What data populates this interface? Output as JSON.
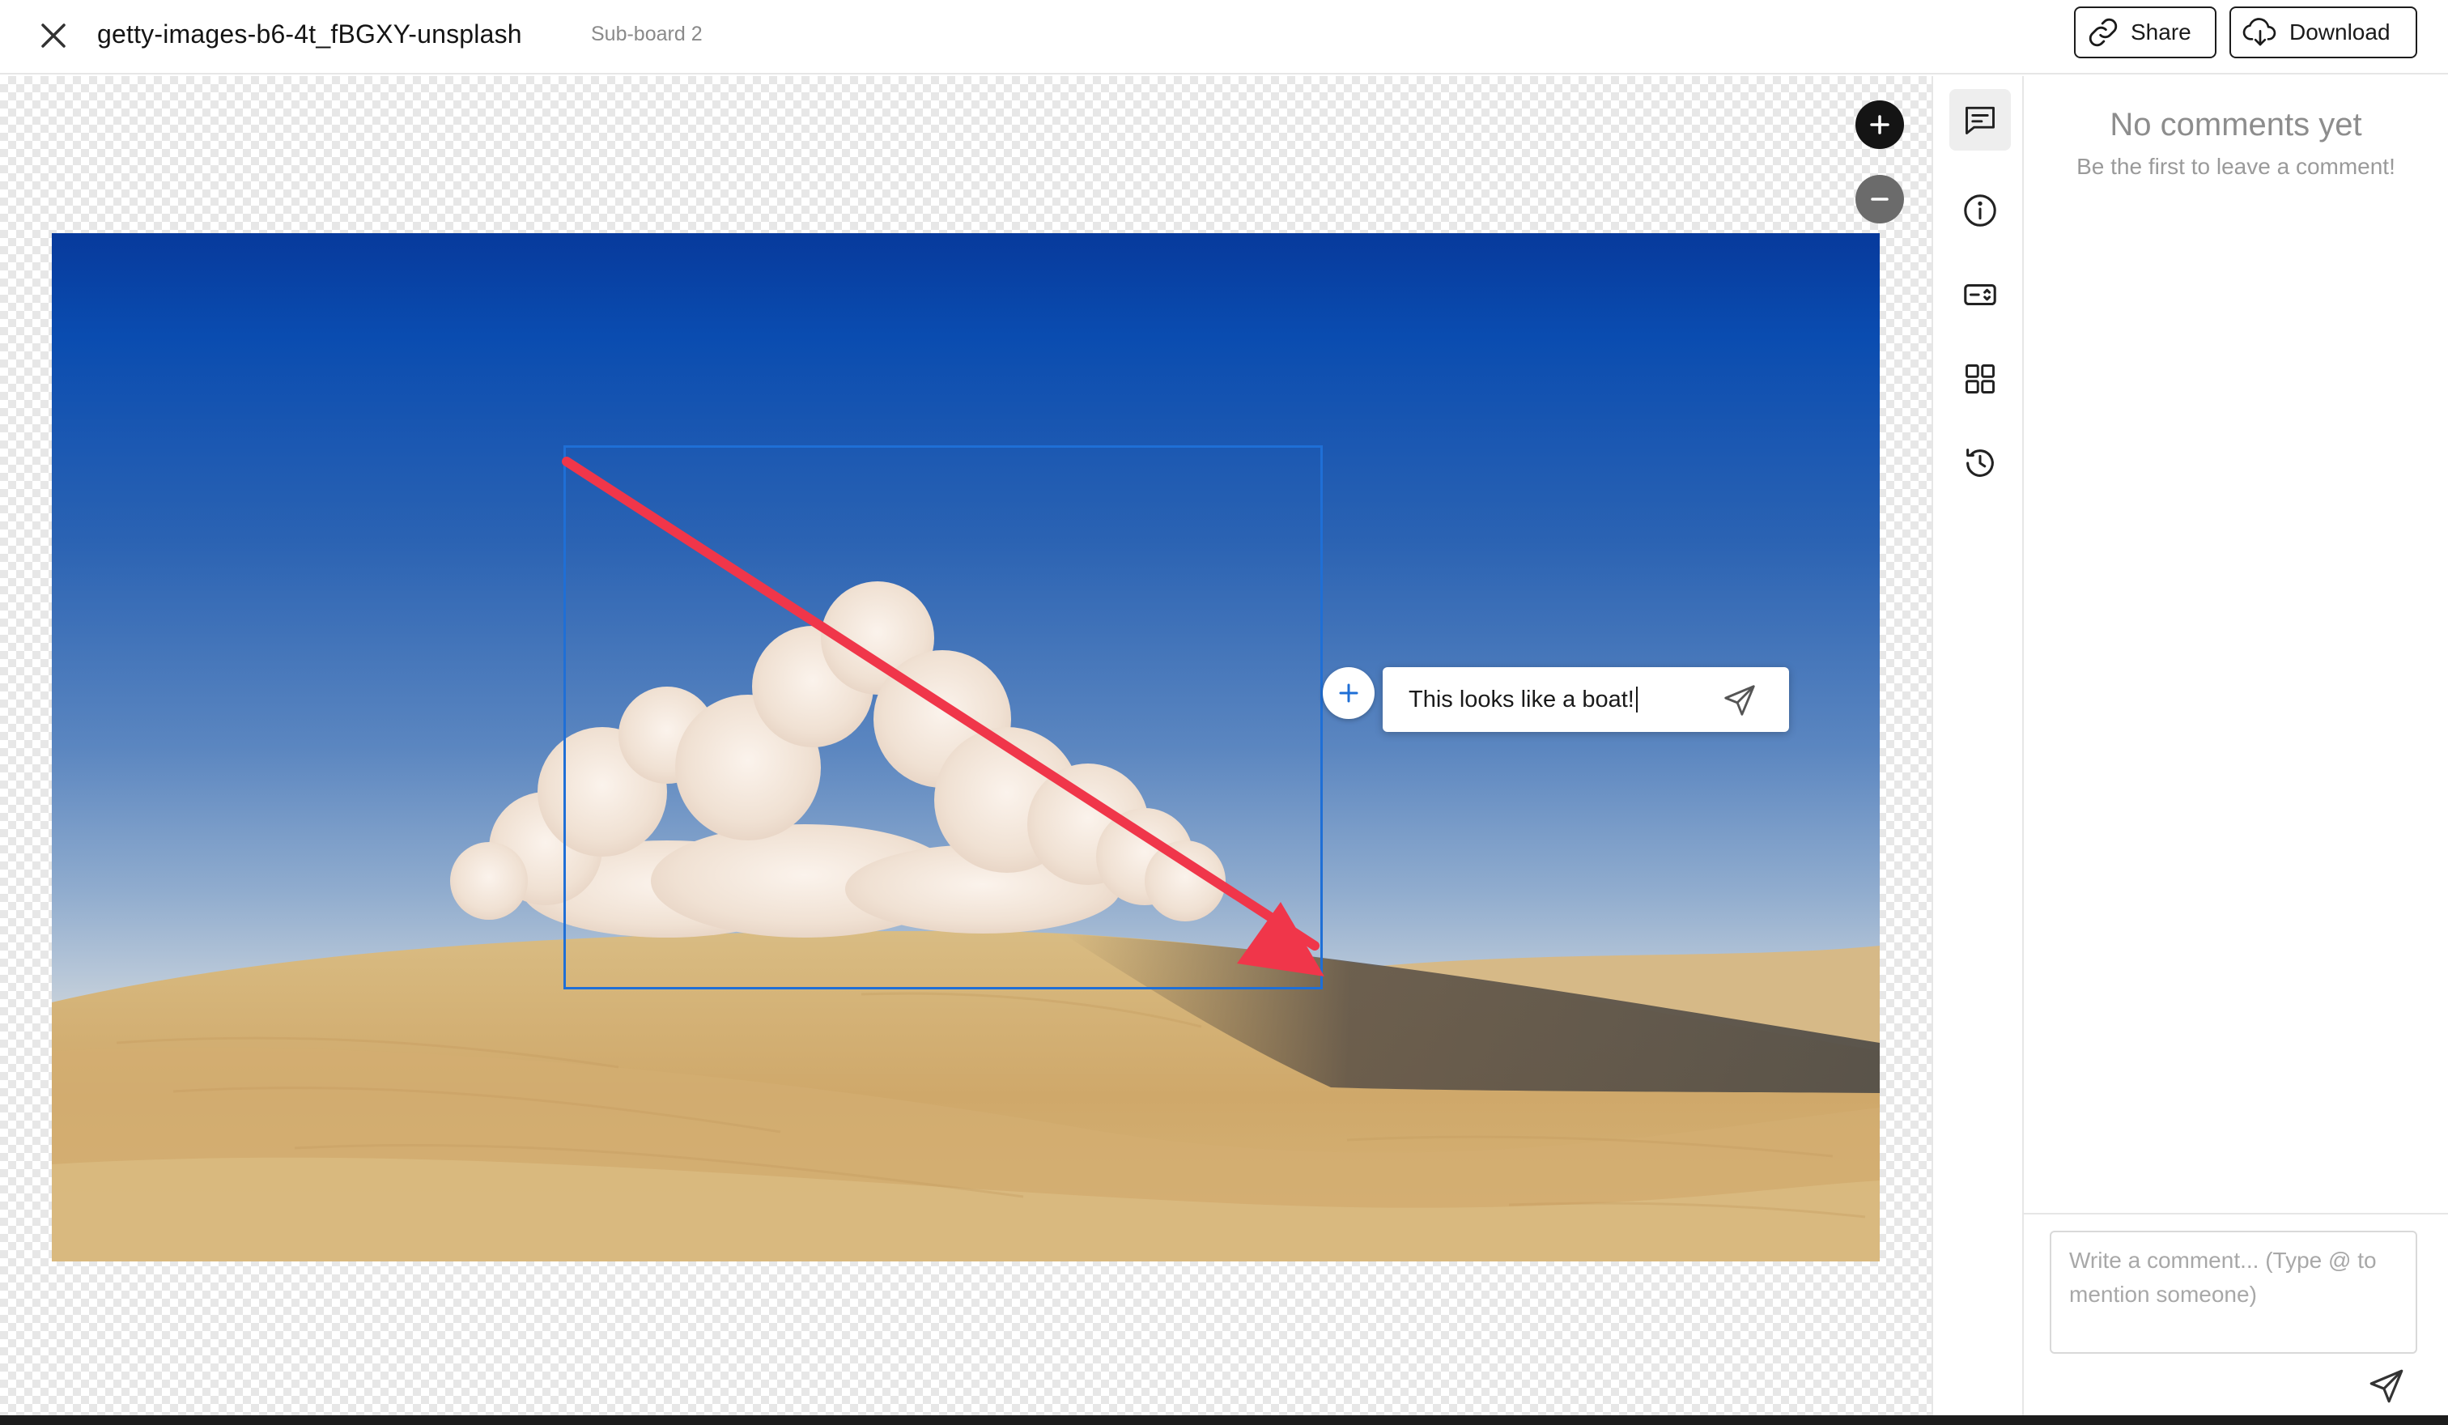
{
  "header": {
    "title": "getty-images-b6-4t_fBGXY-unsplash",
    "subtitle": "Sub-board 2",
    "share_label": "Share",
    "download_label": "Download",
    "icons": {
      "close": "close-icon",
      "share": "link-icon",
      "download": "cloud-download-icon"
    }
  },
  "canvas": {
    "zoom_in_icon": "plus-icon",
    "zoom_out_icon": "minus-icon",
    "image_description_colors": {
      "sky": "#0a4cb0",
      "sand": "#d8b57a"
    },
    "annotation": {
      "arrow_color": "#f0364a",
      "selection_color": "#1f6fd6"
    },
    "comment_popup": {
      "text": "This looks like a boat!",
      "add_icon": "plus-icon",
      "send_icon": "send-icon"
    }
  },
  "toolstrip": [
    {
      "icon": "comment-icon",
      "active": true
    },
    {
      "icon": "info-icon",
      "active": false
    },
    {
      "icon": "compare-icon",
      "active": false
    },
    {
      "icon": "grid-icon",
      "active": false
    },
    {
      "icon": "history-icon",
      "active": false
    }
  ],
  "comments_panel": {
    "empty_title": "No comments yet",
    "empty_subtitle": "Be the first to leave a comment!",
    "input_placeholder": "Write a comment... (Type @ to mention someone)",
    "send_icon": "send-icon"
  }
}
